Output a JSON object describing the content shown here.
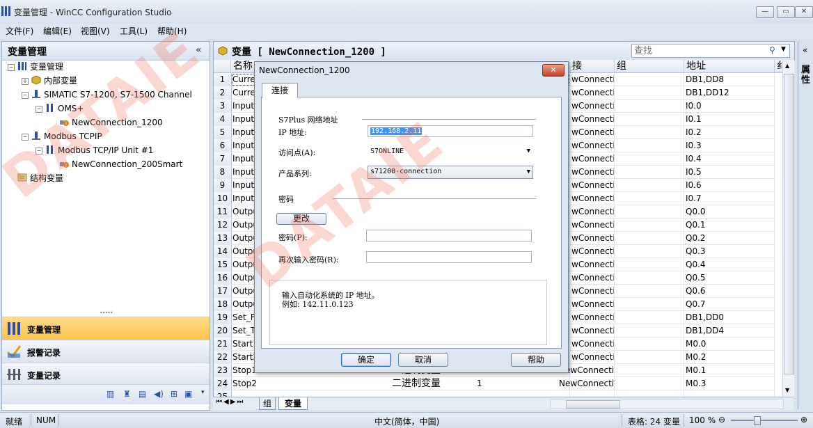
{
  "window": {
    "title": "变量管理 - WinCC Configuration Studio",
    "minimize": "—",
    "maximize": "▭",
    "close": "✕"
  },
  "menubar": [
    "文件(F)",
    "编辑(E)",
    "视图(V)",
    "工具(L)",
    "帮助(H)"
  ],
  "left_panel": {
    "title": "变量管理",
    "collapse": "«",
    "tree": [
      {
        "label": "变量管理",
        "level": 0,
        "expander": "−",
        "icon": "tag-management-icon"
      },
      {
        "label": "内部变量",
        "level": 1,
        "expander": "+",
        "icon": "internal-tags-icon"
      },
      {
        "label": "SIMATIC S7-1200, S7-1500 Channel",
        "level": 1,
        "expander": "−",
        "icon": "channel-icon"
      },
      {
        "label": "OMS+",
        "level": 2,
        "expander": "−",
        "icon": "channel-unit-icon"
      },
      {
        "label": "NewConnection_1200",
        "level": 3,
        "expander": "",
        "icon": "connection-icon"
      },
      {
        "label": "Modbus TCPIP",
        "level": 1,
        "expander": "−",
        "icon": "channel-icon"
      },
      {
        "label": "Modbus TCP/IP Unit #1",
        "level": 2,
        "expander": "−",
        "icon": "channel-unit-icon"
      },
      {
        "label": "NewConnection_200Smart",
        "level": 3,
        "expander": "",
        "icon": "connection-icon"
      },
      {
        "label": "结构变量",
        "level": 0,
        "expander": "",
        "icon": "struct-tags-icon"
      }
    ],
    "splitter": "•••••",
    "nav": [
      {
        "label": "变量管理",
        "active": true,
        "icon": "tag-management-icon"
      },
      {
        "label": "报警记录",
        "active": false,
        "icon": "alarm-logging-icon"
      },
      {
        "label": "变量记录",
        "active": false,
        "icon": "tag-logging-icon"
      }
    ]
  },
  "main": {
    "title": "变量 [ NewConnection_1200 ]",
    "search_placeholder": "查找",
    "columns": [
      "名称",
      "接",
      "组",
      "地址",
      "纟"
    ],
    "rows": [
      {
        "n": "1",
        "name": "Curre",
        "conn": "wConnectic",
        "addr": "DB1,DD8"
      },
      {
        "n": "2",
        "name": "Curre",
        "conn": "wConnectic",
        "addr": "DB1,DD12"
      },
      {
        "n": "3",
        "name": "Input_",
        "conn": "wConnectic",
        "addr": "I0.0"
      },
      {
        "n": "4",
        "name": "Input_",
        "conn": "wConnectic",
        "addr": "I0.1"
      },
      {
        "n": "5",
        "name": "Input_",
        "conn": "wConnectic",
        "addr": "I0.2"
      },
      {
        "n": "6",
        "name": "Input_",
        "conn": "wConnectic",
        "addr": "I0.3"
      },
      {
        "n": "7",
        "name": "Input_",
        "conn": "wConnectic",
        "addr": "I0.4"
      },
      {
        "n": "8",
        "name": "Input_",
        "conn": "wConnectic",
        "addr": "I0.5"
      },
      {
        "n": "9",
        "name": "Input_",
        "conn": "wConnectic",
        "addr": "I0.6"
      },
      {
        "n": "10",
        "name": "Input_",
        "conn": "wConnectic",
        "addr": "I0.7"
      },
      {
        "n": "11",
        "name": "Outpu",
        "conn": "wConnectic",
        "addr": "Q0.0"
      },
      {
        "n": "12",
        "name": "Outpu",
        "conn": "wConnectic",
        "addr": "Q0.1"
      },
      {
        "n": "13",
        "name": "Outpu",
        "conn": "wConnectic",
        "addr": "Q0.2"
      },
      {
        "n": "14",
        "name": "Outpu",
        "conn": "wConnectic",
        "addr": "Q0.3"
      },
      {
        "n": "15",
        "name": "Outpu",
        "conn": "wConnectic",
        "addr": "Q0.4"
      },
      {
        "n": "16",
        "name": "Outpu",
        "conn": "wConnectic",
        "addr": "Q0.5"
      },
      {
        "n": "17",
        "name": "Outpu",
        "conn": "wConnectic",
        "addr": "Q0.6"
      },
      {
        "n": "18",
        "name": "Outpu",
        "conn": "wConnectic",
        "addr": "Q0.7"
      },
      {
        "n": "19",
        "name": "Set_F",
        "conn": "wConnectic",
        "addr": "DB1,DD0"
      },
      {
        "n": "20",
        "name": "Set_T",
        "conn": "wConnectic",
        "addr": "DB1,DD4"
      },
      {
        "n": "21",
        "name": "Start1",
        "conn": "wConnectic",
        "addr": "M0.0"
      },
      {
        "n": "22",
        "name": "Start2",
        "conn": "wConnectic",
        "addr": "M0.2"
      },
      {
        "n": "23",
        "name": "Stop1",
        "conn": "NewConnectic",
        "addr": "M0.1",
        "type": "二进制变量",
        "len": "1"
      },
      {
        "n": "24",
        "name": "Stop2",
        "conn": "NewConnectic",
        "addr": "M0.3",
        "type": "二进制变量",
        "len": "1"
      },
      {
        "n": "25",
        "name": "",
        "conn": "",
        "addr": ""
      }
    ],
    "bottom_tabs": [
      "组",
      "变量"
    ],
    "right_strip_label": "属性"
  },
  "dialog": {
    "title": "NewConnection_1200",
    "close": "✕",
    "tab": "连接",
    "section_address": "S7Plus 网络地址",
    "ip_label": "IP 地址:",
    "ip_value": "192.168.2.11",
    "access_label": "访问点(A):",
    "access_value": "S7ONLINE",
    "family_label": "产品系列:",
    "family_value": "s71200-connection",
    "section_password": "密码",
    "change_button": "更改",
    "password_label": "密码(P):",
    "password_value": "",
    "password2_label": "再次输入密码(R):",
    "password2_value": "",
    "hint_line1": "输入自动化系统的 IP 地址。",
    "hint_line2": "例如: 142.11.0.123",
    "ok": "确定",
    "cancel": "取消",
    "help": "帮助"
  },
  "statusbar": {
    "ready": "就绪",
    "num": "NUM",
    "locale": "中文(简体，中国)",
    "table_info": "表格: 24 变量",
    "zoom": "100 %",
    "zoom_level": 0.4
  },
  "watermark": "DATAIE",
  "colors": {
    "active_nav": "#ffc24a",
    "selection": "#3399ff",
    "watermark": "#f06e5a"
  }
}
